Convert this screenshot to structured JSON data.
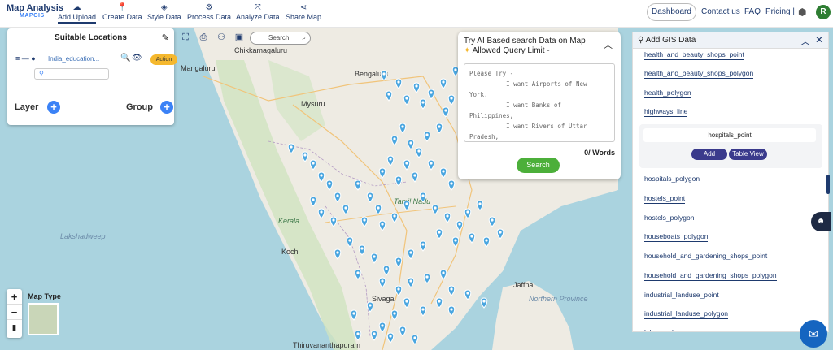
{
  "logo": {
    "title": "Map Analysis",
    "sub_prefix": "MAP",
    "sub_suffix": "GIS"
  },
  "nav": [
    {
      "label": "Add Upload",
      "icon": "cloud-upload-icon",
      "active": true
    },
    {
      "label": "Create Data",
      "icon": "map-pin-icon"
    },
    {
      "label": "Style Data",
      "icon": "paint-bucket-icon"
    },
    {
      "label": "Process Data",
      "icon": "process-icon"
    },
    {
      "label": "Analyze Data",
      "icon": "analyze-icon"
    },
    {
      "label": "Share Map",
      "icon": "share-icon"
    }
  ],
  "header": {
    "dashboard": "Dashboard",
    "contact": "Contact us",
    "faq": "FAQ",
    "pricing": "Pricing |",
    "avatar": "R"
  },
  "left_panel": {
    "title": "Suitable Locations",
    "layer_name": "India_education...",
    "action_label": "Action",
    "layer_label": "Layer",
    "group_label": "Group"
  },
  "map_search": {
    "placeholder": "Search"
  },
  "ai_panel": {
    "title": "Try AI Based search Data on Map",
    "subtitle": "Allowed Query Limit -",
    "placeholder_text": "Please Try -\n          I want Airports of New\nYork,\n          I want Banks of\nPhilippines,\n          I want Rivers of Uttar\nPradesh,\n          I want Atms of London",
    "words": "0/ Words",
    "search_label": "Search"
  },
  "gis_panel": {
    "title": "Add GIS Data",
    "items_top": [
      "health_and_beauty_shops_point",
      "health_and_beauty_shops_polygon",
      "health_polygon",
      "highways_line"
    ],
    "selected": {
      "name": "hospitals_point",
      "add_label": "Add",
      "table_label": "Table View"
    },
    "items_bottom": [
      "hospitals_polygon",
      "hostels_point",
      "hostels_polygon",
      "houseboats_polygon",
      "household_and_gardening_shops_point",
      "household_and_gardening_shops_polygon",
      "industrial_landuse_point",
      "industrial_landuse_polygon",
      "lakes_polygon"
    ]
  },
  "map_labels": {
    "mangaluru": "Mangaluru",
    "chikkamagaluru": "Chikkamagaluru",
    "bengaluru": "Bengaluru",
    "mysuru": "Mysuru",
    "kerala": "Kerala",
    "lakshadweep": "Lakshadweep",
    "kochi": "Kochi",
    "jaffna": "Jaffna",
    "northern_province": "Northern Province",
    "thiruvananthapuram": "Thiruvananthapuram",
    "tamil_nadu": "Tamil Nadu",
    "sivagangai": "Sivaga"
  },
  "map_type": {
    "label": "Map Type"
  },
  "zoom": {
    "in": "+",
    "out": "−"
  }
}
